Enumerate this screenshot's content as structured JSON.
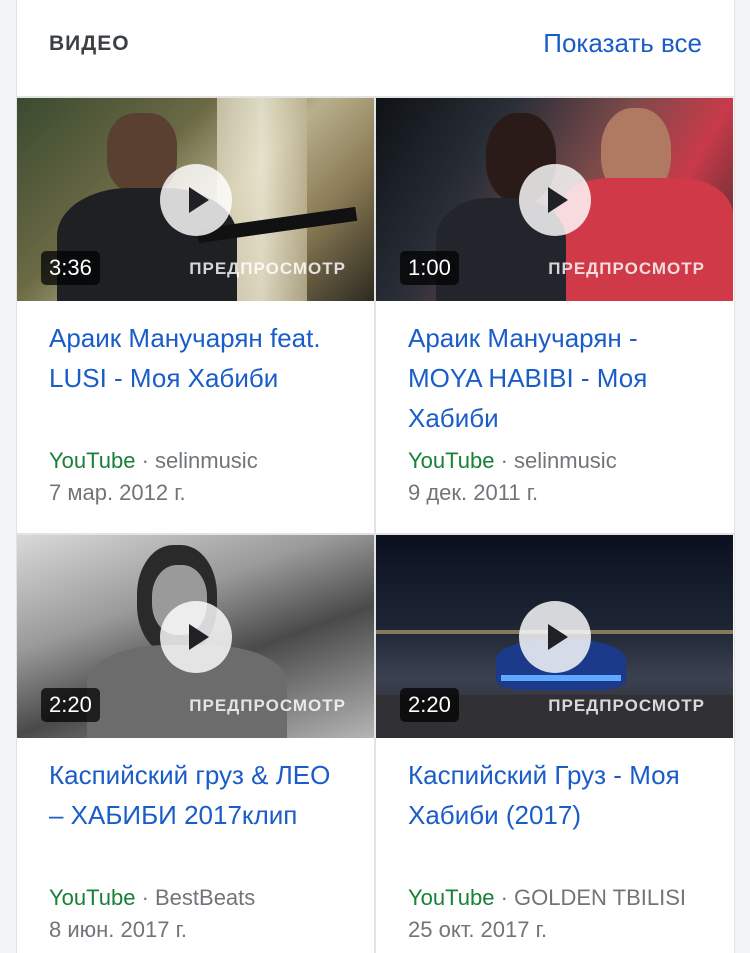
{
  "header": {
    "title": "ВИДЕО",
    "show_all": "Показать все"
  },
  "videos": [
    {
      "duration": "3:36",
      "preview": "ПРЕДПРОСМОТР",
      "title": "Араик Манучарян feat. LUSI - Моя Хабиби",
      "source": "YouTube",
      "channel": " · selinmusic",
      "date": "7 мар. 2012 г."
    },
    {
      "duration": "1:00",
      "preview": "ПРЕДПРОСМОТР",
      "title": "Араик Манучарян - MOYA HABIBI - Моя Хабиби",
      "source": "YouTube",
      "channel": " · selinmusic",
      "date": "9 дек. 2011 г."
    },
    {
      "duration": "2:20",
      "preview": "ПРЕДПРОСМОТР",
      "title": "Каспийский груз & ЛЕО – ХАБИБИ 2017клип",
      "source": "YouTube",
      "channel": " · BestBeats",
      "date": "8 июн. 2017 г."
    },
    {
      "duration": "2:20",
      "preview": "ПРЕДПРОСМОТР",
      "title": "Каспийский Груз - Моя Хабиби (2017)",
      "source": "YouTube",
      "channel": " · GOLDEN TBILISI",
      "date": "25 окт. 2017 г."
    }
  ]
}
